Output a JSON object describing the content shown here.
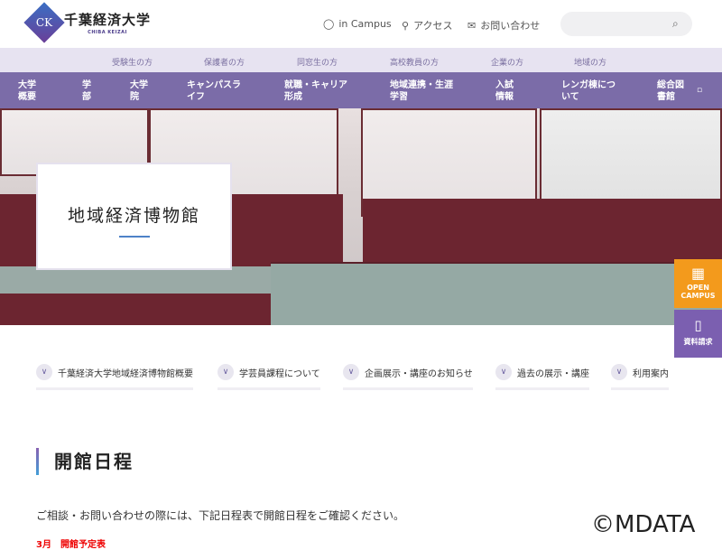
{
  "header": {
    "logo_mark": "CK",
    "logo_text": "千葉経済大学",
    "logo_sub": "CHIBA KEIZAI",
    "utility": [
      {
        "icon": "user-icon",
        "label": "in Campus"
      },
      {
        "icon": "map-pin-icon",
        "label": "アクセス"
      },
      {
        "icon": "mail-icon",
        "label": "お問い合わせ"
      }
    ],
    "search_placeholder": ""
  },
  "subnav": [
    "受験生の方",
    "保護者の方",
    "同窓生の方",
    "高校教員の方",
    "企業の方",
    "地域の方"
  ],
  "mainnav": [
    "大学\n概要",
    "学\n部",
    "大学\n院",
    "キャンパスラ\nイフ",
    "就職・キャリア\n形成",
    "地域連携・生涯\n学習",
    "入試\n情報",
    "レンガ棟につ\nいて",
    "総合図\n書館"
  ],
  "hero": {
    "title": "地域経済博物館"
  },
  "side_buttons": {
    "open_campus": "OPEN CAMPUS",
    "request": "資料請求"
  },
  "anchors": [
    "千葉経済大学地域経済博物館概要",
    "学芸員課程について",
    "企画展示・講座のお知らせ",
    "過去の展示・講座",
    "利用案内"
  ],
  "section": {
    "heading": "開館日程",
    "intro": "ご相談・お問い合わせの際には、下記日程表で開館日程をご確認ください。",
    "red_label": "3月　開館予定表"
  },
  "watermark": "©MDATA",
  "colors": {
    "nav": "#7b6ca8",
    "subnav": "#e7e3f1",
    "open_campus": "#f39a1c",
    "request": "#7b5fb0"
  }
}
